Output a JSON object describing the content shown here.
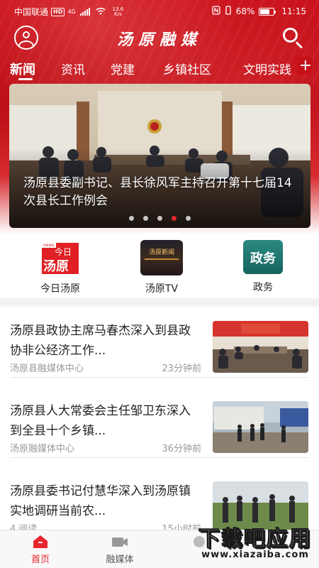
{
  "status_bar": {
    "carrier": "中国联通",
    "network_badge": "HD",
    "network_type": "4G",
    "speed_value": "13.6",
    "speed_unit": "K/s",
    "battery": "68%",
    "time": "11:15",
    "icons": [
      "nfc-icon",
      "battery-icon",
      "wifi-icon",
      "signal-icon"
    ]
  },
  "header": {
    "app_title": "汤原融媒",
    "icons": {
      "left": "user-avatar-icon",
      "right": "search-icon"
    },
    "brand_color": "#c8101a"
  },
  "tabs": {
    "items": [
      "新闻",
      "资讯",
      "党建",
      "乡镇社区",
      "文明实践"
    ],
    "active_index": 0,
    "add_icon": "plus-icon"
  },
  "carousel": {
    "caption": "汤原县委副书记、县长徐风军主持召开第十七届14次县长工作例会",
    "slide_count": 5,
    "active_slide": 3
  },
  "shortcuts": [
    {
      "label": "今日汤原",
      "icon": "today-tangyuan-icon",
      "icon_text_top": "今日",
      "icon_text_bottom": "汤原",
      "icon_badge": "news"
    },
    {
      "label": "汤原TV",
      "icon": "tangyuan-tv-icon",
      "icon_text": "汤原新闻"
    },
    {
      "label": "政务",
      "icon": "government-affairs-icon",
      "icon_text": "政务"
    }
  ],
  "news": [
    {
      "title": "汤原县政协主席马春杰深入到县政协非公经济工作...",
      "source": "汤原县融媒体中心",
      "time": "23分钟前"
    },
    {
      "title": "汤原县人大常委会主任邹卫东深入到全县十个乡镇...",
      "source": "汤原融媒体中心",
      "time": "36分钟前"
    },
    {
      "title": "汤原县委书记付慧华深入到汤原镇实地调研当前农...",
      "source": "4 阅读",
      "time": "15小时前"
    }
  ],
  "bottom_nav": {
    "items": [
      {
        "label": "首页",
        "icon": "home-icon"
      },
      {
        "label": "融媒体",
        "icon": "video-camera-icon"
      },
      {
        "label": "",
        "icon": "partial-nav-icon"
      }
    ],
    "active_index": 0,
    "active_color": "#e8262c"
  },
  "watermark": {
    "main": "下载吧应用",
    "sub": "www.xiazaiba.com"
  }
}
